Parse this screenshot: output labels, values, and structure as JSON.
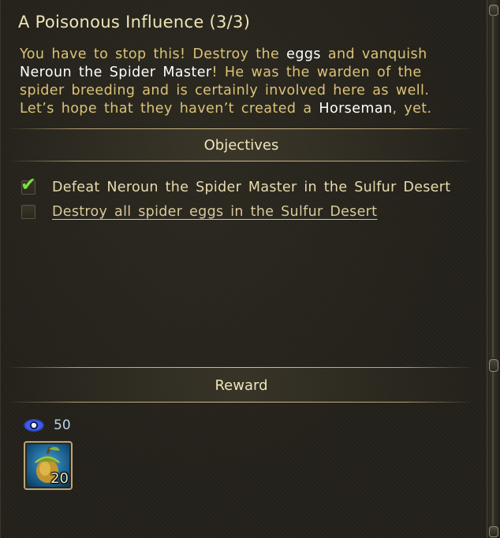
{
  "quest": {
    "title": "A Poisonous Influence (3/3)",
    "description": {
      "t1": "You have to stop this! Destroy the ",
      "h1": "eggs",
      "t2": " and vanquish ",
      "h2": "Neroun the Spider Master",
      "t3": "! He was the warden of the spider breeding and is certainly involved here as well. Let’s hope that they haven’t created a ",
      "h3": "Horseman",
      "t4": ", yet."
    }
  },
  "objectives": {
    "heading": "Objectives",
    "items": [
      {
        "label": "Defeat Neroun the Spider Master in the Sulfur Desert",
        "completed": true
      },
      {
        "label": "Destroy all spider eggs in the Sulfur Desert",
        "completed": false
      }
    ]
  },
  "reward": {
    "heading": "Reward",
    "xp": {
      "icon": "experience-eye-icon",
      "value": "50"
    },
    "item": {
      "icon": "acorn-icon",
      "count": "20"
    }
  },
  "colors": {
    "title": "#efe5b8",
    "text": "#dcc277",
    "highlight": "#ffffff",
    "check": "#7fdc45",
    "xp_value": "#bcd3ec"
  }
}
